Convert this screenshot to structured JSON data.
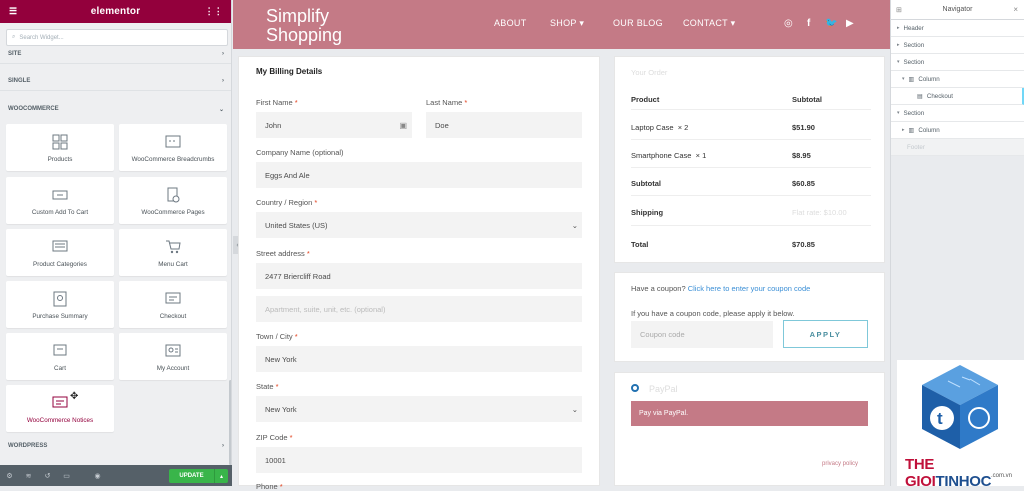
{
  "editor": {
    "brand": "elementor",
    "search_placeholder": "Search Widget...",
    "categories": [
      "SITE",
      "SINGLE",
      "WOOCOMMERCE",
      "WORDPRESS"
    ],
    "widgets": [
      {
        "label": "Products",
        "icon": "products-icon"
      },
      {
        "label": "WooCommerce Breadcrumbs",
        "icon": "breadcrumbs-icon"
      },
      {
        "label": "Custom Add To Cart",
        "icon": "add-to-cart-icon"
      },
      {
        "label": "WooCommerce Pages",
        "icon": "pages-icon"
      },
      {
        "label": "Product Categories",
        "icon": "categories-icon"
      },
      {
        "label": "Menu Cart",
        "icon": "cart-icon"
      },
      {
        "label": "Purchase Summary",
        "icon": "summary-icon"
      },
      {
        "label": "Checkout",
        "icon": "checkout-icon"
      },
      {
        "label": "Cart",
        "icon": "cart-widget-icon"
      },
      {
        "label": "My Account",
        "icon": "account-icon"
      },
      {
        "label": "WooCommerce Notices",
        "icon": "notices-icon"
      }
    ],
    "update_label": "UPDATE"
  },
  "site": {
    "logo_line1": "Simplify",
    "logo_line2": "Shopping",
    "nav": [
      "ABOUT",
      "SHOP",
      "OUR BLOG",
      "CONTACT"
    ]
  },
  "billing": {
    "title": "My Billing Details",
    "first_name_label": "First Name",
    "first_name": "John",
    "last_name_label": "Last Name",
    "last_name": "Doe",
    "company_label": "Company Name (optional)",
    "company": "Eggs And Ale",
    "country_label": "Country / Region",
    "country": "United States (US)",
    "street_label": "Street address",
    "street": "2477 Briercliff Road",
    "apartment_placeholder": "Apartment, suite, unit, etc. (optional)",
    "city_label": "Town / City",
    "city": "New York",
    "state_label": "State",
    "state": "New York",
    "zip_label": "ZIP Code",
    "zip": "10001",
    "phone_label": "Phone",
    "required_mark": "*"
  },
  "order": {
    "title": "Your Order",
    "col_product": "Product",
    "col_subtotal": "Subtotal",
    "items": [
      {
        "name": "Laptop Case",
        "qty": "× 2",
        "price": "$51.90"
      },
      {
        "name": "Smartphone Case",
        "qty": "× 1",
        "price": "$8.95"
      }
    ],
    "subtotal_label": "Subtotal",
    "subtotal": "$60.85",
    "shipping_label": "Shipping",
    "shipping": "Flat rate: $10.00",
    "total_label": "Total",
    "total": "$70.85"
  },
  "coupon": {
    "question": "Have a coupon?",
    "link": "Click here to enter your coupon code",
    "hint": "If you have a coupon code, please apply it below.",
    "placeholder": "Coupon code",
    "apply": "APPLY"
  },
  "payment": {
    "method": "PayPal",
    "note": "Pay via PayPal.",
    "policy": "privacy policy"
  },
  "navigator": {
    "title": "Navigator",
    "items": [
      "Header",
      "Section",
      "Section",
      "Column",
      "Checkout",
      "Section",
      "Column",
      "Footer"
    ]
  },
  "watermark": {
    "text1": "THE GIOI",
    "text2": "TINHOC",
    "domain": ".com.vn"
  },
  "colors": {
    "accent": "#93003c",
    "header": "#c47a86",
    "update": "#39b54a",
    "paypal_note": "#c47a86"
  }
}
